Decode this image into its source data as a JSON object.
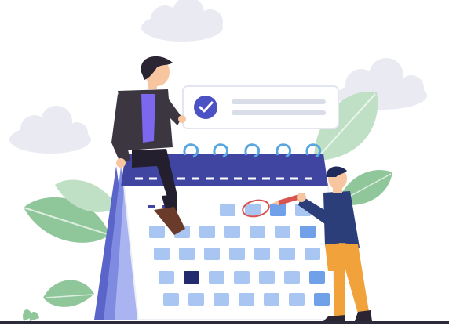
{
  "illustration": {
    "subject": "calendar-scheduling",
    "calendar": {
      "header_color": "#3f45a0",
      "body_color": "#ffffff",
      "cell_color": "#a9c6f2",
      "highlight_cell_color": "#232a6e",
      "circled_mark_color": "#d9534f",
      "ring_color": "#5aa6e0",
      "grid_rows": 5,
      "grid_cols": 7
    },
    "notification_card": {
      "icon": "check-circle-icon",
      "accent_color": "#4b52c4"
    },
    "people": [
      {
        "role": "sitting-person",
        "shirt_color": "#3b3640",
        "accent_color": "#7b68ee"
      },
      {
        "role": "standing-person-with-pencil",
        "shirt_color": "#2c3e7a",
        "pants_color": "#f2a23a"
      }
    ],
    "decorations": {
      "cloud_color": "#e9eaf2",
      "leaf_color": "#8fc69a",
      "leaf_light_color": "#bfe0c4"
    }
  }
}
